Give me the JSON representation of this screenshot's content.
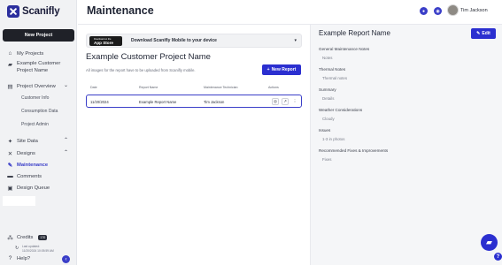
{
  "app": {
    "name": "Scanifly"
  },
  "sidebar": {
    "new_project_label": "New Project",
    "items": [
      {
        "label": "My Projects",
        "icon": "home-icon"
      },
      {
        "label": "Example Customer Project Name",
        "icon": "folder-icon"
      },
      {
        "label": "Project Overview",
        "icon": "clipboard-icon"
      },
      {
        "label": "Site Data",
        "icon": "layers-icon"
      },
      {
        "label": "Designs",
        "icon": "tools-icon"
      },
      {
        "label": "Maintenance",
        "icon": "wrench-icon"
      },
      {
        "label": "Comments",
        "icon": "comment-icon"
      },
      {
        "label": "Design Queue",
        "icon": "queue-icon"
      }
    ],
    "subitems": [
      "Customer Info",
      "Consumption Data",
      "Project Admin"
    ],
    "credits_label": "Credits",
    "credits_count": "170",
    "last_updated_label": "Last updated:",
    "last_updated_value": "11/20/2024 10:05:59 AM",
    "help_label": "Help?"
  },
  "header": {
    "title": "Maintenance",
    "user_name": "Tim Jackson"
  },
  "main": {
    "banner_text": "Download Scanifly Mobile to your device",
    "appstore_small": "Download on the",
    "appstore_big": "App Store",
    "project_title": "Example Customer Project Name",
    "hint": "All images for the report have to be uploaded from Scanifly mobile.",
    "new_report_label": "New Report",
    "table": {
      "headers": [
        "Date",
        "Report Name",
        "Maintenance Technician",
        "Actions"
      ],
      "rows": [
        {
          "date": "11/20/2024",
          "name": "Example Report Name",
          "technician": "Tim Jackson"
        }
      ]
    }
  },
  "panel": {
    "title": "Example Report Name",
    "edit_label": "Edit",
    "fields": [
      {
        "label": "General Maintenance Notes",
        "value": "Notes"
      },
      {
        "label": "Thermal Notes",
        "value": "Thermal notes"
      },
      {
        "label": "Summary",
        "value": "Details"
      },
      {
        "label": "Weather Considerations",
        "value": "Cloudy"
      },
      {
        "label": "Issues",
        "value": "1-3 in photos"
      },
      {
        "label": "Recommended Fixes & Improvements",
        "value": "Fixes"
      }
    ]
  },
  "colors": {
    "accent": "#2b2fd0",
    "dark": "#1f2128"
  }
}
